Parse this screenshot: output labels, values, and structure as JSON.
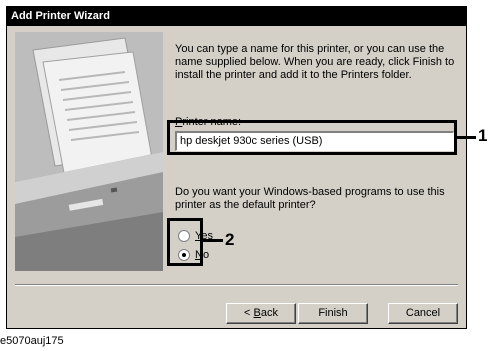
{
  "dialog": {
    "title": "Add Printer Wizard",
    "description": "You can type a name for this printer, or you can use the name supplied below. When you are ready, click Finish to install the printer and add it to the Printers folder.",
    "printer_name_label_rest": "rinter name:",
    "printer_name_label_accel": "P",
    "printer_name_value": "hp deskjet 930c series (USB)",
    "default_question": "Do you want your Windows-based programs to use this printer as the default printer?",
    "radio_yes_accel": "Y",
    "radio_yes_rest": "es",
    "radio_no_accel": "N",
    "radio_no_rest": "o",
    "default_selected": "No",
    "back_prefix": "< ",
    "back_accel": "B",
    "back_rest": "ack",
    "finish_label": "Finish",
    "cancel_label": "Cancel"
  },
  "callouts": [
    "1",
    "2"
  ],
  "caption": "e5070auj175"
}
